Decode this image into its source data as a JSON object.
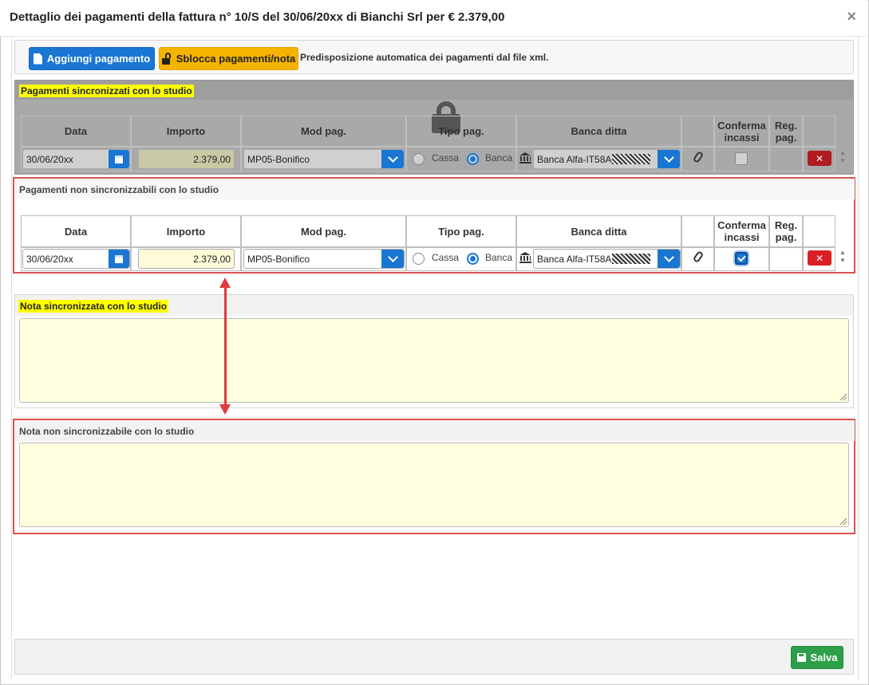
{
  "dialog": {
    "title": "Dettaglio dei pagamenti della fattura n° 10/S del 30/06/20xx di Bianchi Srl per € 2.379,00",
    "close_label": "×"
  },
  "toolbar": {
    "add_payment_label": "Aggiungi pagamento",
    "unlock_label": "Sblocca pagamenti/nota",
    "info_text": "Predisposizione automatica dei pagamenti dal file xml."
  },
  "columns": {
    "data": "Data",
    "importo": "Importo",
    "mod_pag": "Mod pag.",
    "tipo_pag": "Tipo pag.",
    "banca_ditta": "Banca ditta",
    "conferma_line1": "Conferma",
    "conferma_line2": "incassi",
    "reg_line1": "Reg.",
    "reg_line2": "pag."
  },
  "synced": {
    "title": "Pagamenti sincronizzati con lo studio",
    "row": {
      "date": "30/06/20xx",
      "amount": "2.379,00",
      "mod_pag": "MP05-Bonifico",
      "tipo_cassa": "Cassa",
      "tipo_banca": "Banca",
      "tipo_selected": "Banca",
      "bank": "Banca Alfa-IT58A",
      "conferma": false,
      "delete_label": "✕"
    }
  },
  "nonsynced": {
    "title": "Pagamenti non sincronizzabili con lo studio",
    "row": {
      "date": "30/06/20xx",
      "amount": "2.379,00",
      "mod_pag": "MP05-Bonifico",
      "tipo_cassa": "Cassa",
      "tipo_banca": "Banca",
      "tipo_selected": "Banca",
      "bank": "Banca Alfa-IT58A",
      "conferma": true,
      "delete_label": "✕"
    }
  },
  "notes": {
    "synced_title": "Nota sincronizzata con lo studio",
    "synced_value": "",
    "nonsynced_title": "Nota non sincronizzabile con lo studio",
    "nonsynced_value": ""
  },
  "footer": {
    "save_label": "Salva"
  },
  "colors": {
    "primary": "#1976d2",
    "warning": "#f5b400",
    "danger": "#dc1f26",
    "success": "#2e9f49",
    "highlight": "#ffff00",
    "annotation_red": "#d9534f"
  }
}
